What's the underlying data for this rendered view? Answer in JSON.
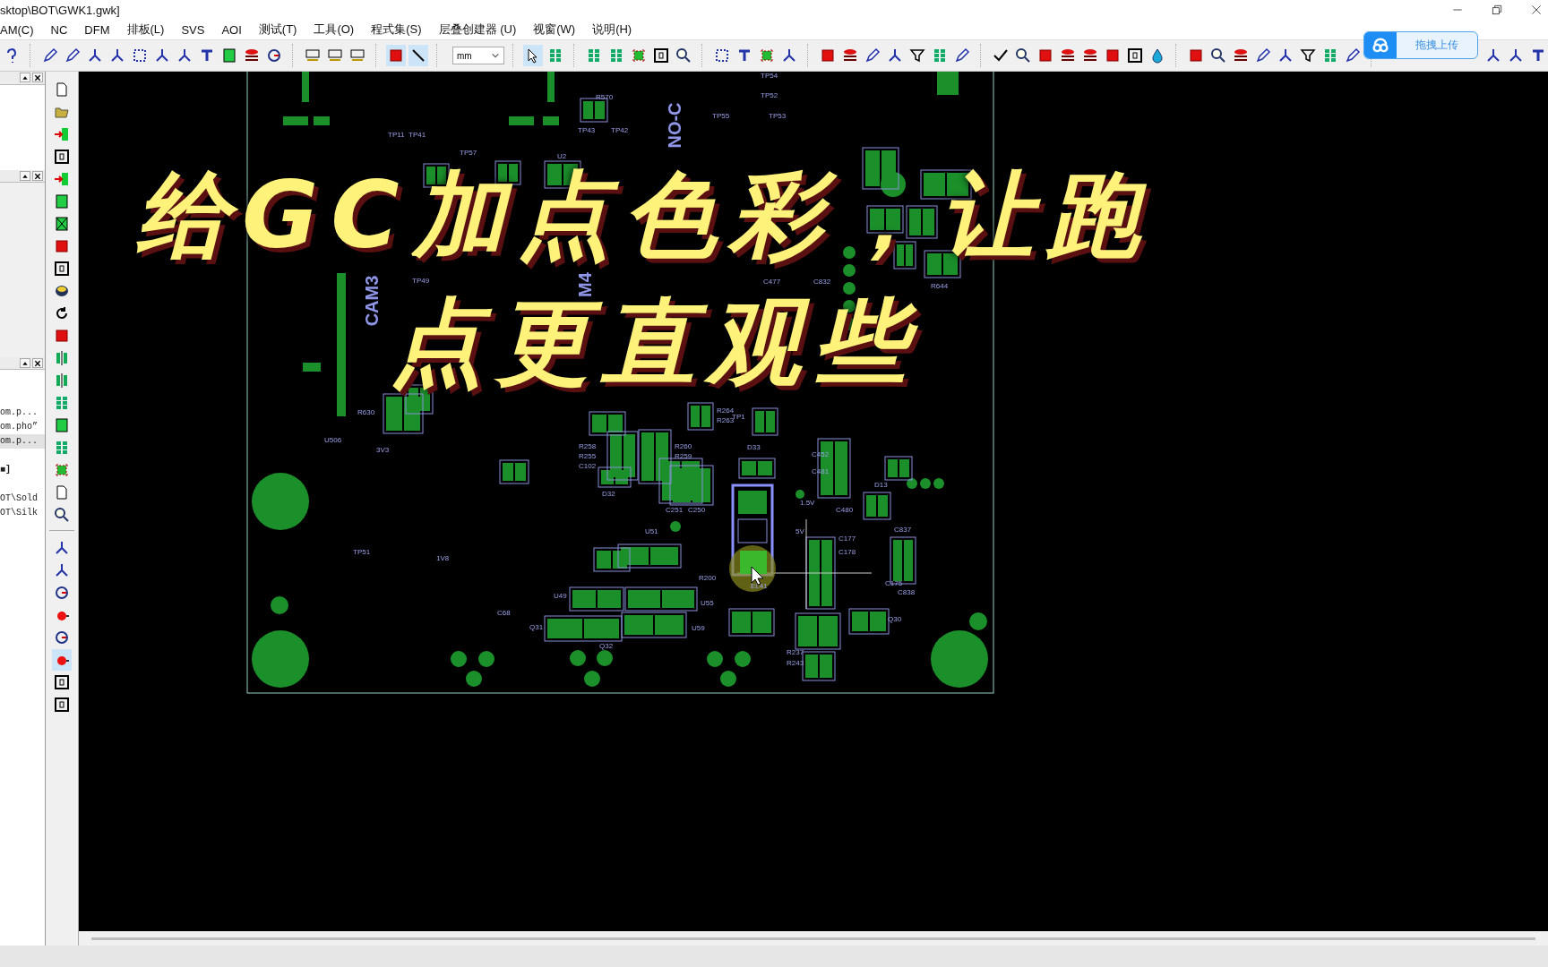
{
  "window": {
    "title": "sktop\\BOT\\GWK1.gwk]"
  },
  "menu": [
    "AM(C)",
    "NC",
    "DFM",
    "排板(L)",
    "SVS",
    "AOI",
    "测试(T)",
    "工具(O)",
    "程式集(S)",
    "层叠创建器 (U)",
    "视窗(W)",
    "说明(H)"
  ],
  "toolbar": {
    "unit_select": {
      "value": "mm"
    }
  },
  "upload_button": {
    "label": "拖拽上传"
  },
  "file_panel": {
    "lines": [
      {
        "text": "om.p...",
        "selected": false
      },
      {
        "text": "om.pho”",
        "selected": false
      },
      {
        "text": "om.p...",
        "selected": true
      },
      {
        "text": "■]",
        "selected": false
      },
      {
        "text": "OT\\Sold",
        "selected": false
      },
      {
        "text": "OT\\Silk",
        "selected": false
      }
    ]
  },
  "board": {
    "labels": [
      {
        "text": "TP54",
        "kind": "silk"
      },
      {
        "text": "TP52",
        "kind": "silk"
      },
      {
        "text": "TP55",
        "kind": "silk"
      },
      {
        "text": "TP53",
        "kind": "silk"
      },
      {
        "text": "TP11",
        "kind": "silk"
      },
      {
        "text": "TP41",
        "kind": "silk"
      },
      {
        "text": "TP57",
        "kind": "silk"
      },
      {
        "text": "TP43",
        "kind": "silk"
      },
      {
        "text": "TP42",
        "kind": "silk"
      },
      {
        "text": "R570",
        "kind": "silk"
      },
      {
        "text": "U2",
        "kind": "silk"
      },
      {
        "text": "CAM3",
        "kind": "big"
      },
      {
        "text": "TP49",
        "kind": "silk"
      },
      {
        "text": "M4",
        "kind": "big"
      },
      {
        "text": "NO-C",
        "kind": "big"
      },
      {
        "text": "C477",
        "kind": "silk"
      },
      {
        "text": "C832",
        "kind": "silk"
      },
      {
        "text": "R644",
        "kind": "silk"
      },
      {
        "text": "U506",
        "kind": "silk"
      },
      {
        "text": "R630",
        "kind": "silk"
      },
      {
        "text": "3V3",
        "kind": "silk"
      },
      {
        "text": "TP51",
        "kind": "silk"
      },
      {
        "text": "1V8",
        "kind": "silk"
      },
      {
        "text": "C68",
        "kind": "silk"
      },
      {
        "text": "TP1",
        "kind": "silk"
      },
      {
        "text": "D33",
        "kind": "silk"
      },
      {
        "text": "C452",
        "kind": "silk"
      },
      {
        "text": "C481",
        "kind": "silk"
      },
      {
        "text": "C480",
        "kind": "silk"
      },
      {
        "text": "1.5V",
        "kind": "silk"
      },
      {
        "text": "D13",
        "kind": "silk"
      },
      {
        "text": "EL41",
        "kind": "silk"
      },
      {
        "text": "U51",
        "kind": "silk"
      },
      {
        "text": "R200",
        "kind": "silk"
      },
      {
        "text": "U49",
        "kind": "silk"
      },
      {
        "text": "U55",
        "kind": "silk"
      },
      {
        "text": "U59",
        "kind": "silk"
      },
      {
        "text": "Q31",
        "kind": "silk"
      },
      {
        "text": "Q32",
        "kind": "silk"
      },
      {
        "text": "R237",
        "kind": "silk"
      },
      {
        "text": "R243",
        "kind": "silk"
      },
      {
        "text": "C177",
        "kind": "silk"
      },
      {
        "text": "C178",
        "kind": "silk"
      },
      {
        "text": "C175",
        "kind": "silk"
      },
      {
        "text": "Q30",
        "kind": "silk"
      },
      {
        "text": "C837",
        "kind": "silk"
      },
      {
        "text": "C838",
        "kind": "silk"
      },
      {
        "text": "R264",
        "kind": "silk"
      },
      {
        "text": "R263",
        "kind": "silk"
      },
      {
        "text": "R258",
        "kind": "silk"
      },
      {
        "text": "R255",
        "kind": "silk"
      },
      {
        "text": "C102",
        "kind": "silk"
      },
      {
        "text": "D32",
        "kind": "silk"
      },
      {
        "text": "C251",
        "kind": "silk"
      },
      {
        "text": "C250",
        "kind": "silk"
      },
      {
        "text": "R260",
        "kind": "silk"
      },
      {
        "text": "R259",
        "kind": "silk"
      },
      {
        "text": "5V",
        "kind": "silk"
      }
    ]
  },
  "caption": {
    "lines": [
      "给GC加点色彩，让跑",
      "点更直观些"
    ]
  }
}
